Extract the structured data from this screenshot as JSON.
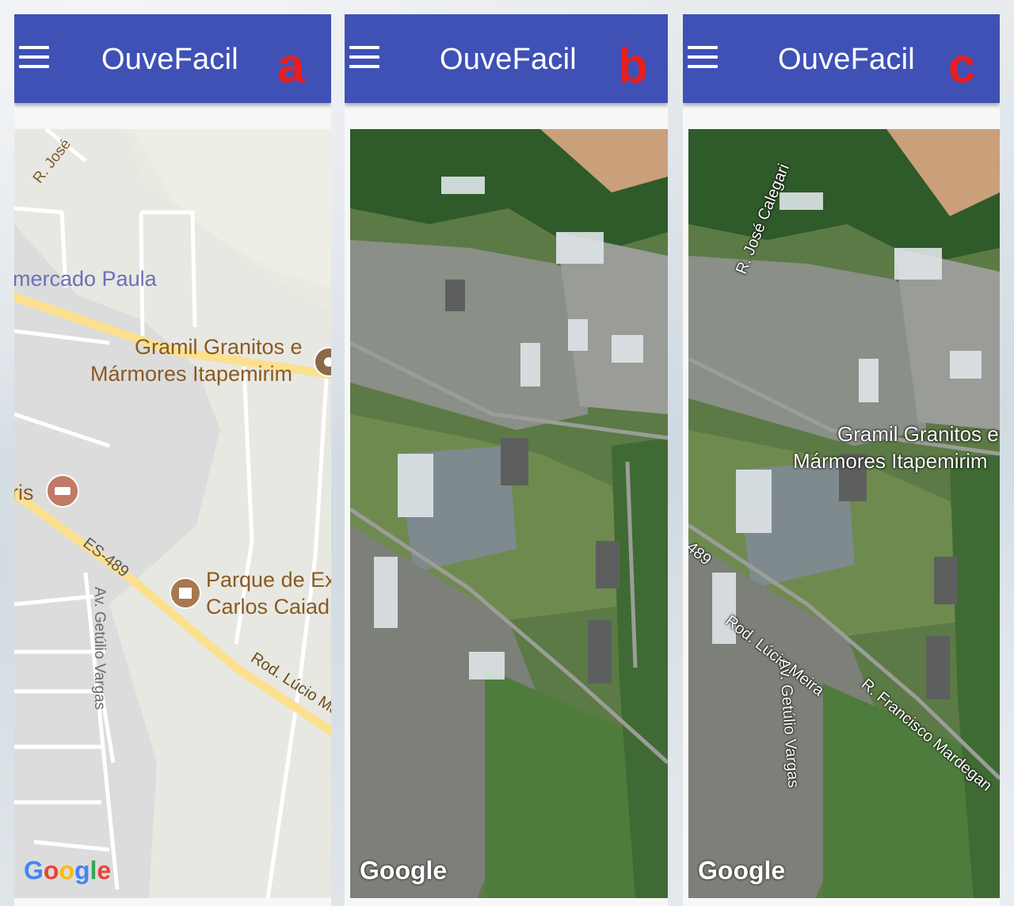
{
  "app": {
    "title": "OuveFacil",
    "accent_color": "#3f51b5",
    "label_color": "#e81e1e"
  },
  "panels": [
    {
      "letter": "a",
      "map_type": "roadmap",
      "labels": {
        "road_jose": "R. José",
        "mercado": "mercado Paula",
        "gramil_1": "Gramil Granitos e",
        "gramil_2": "Mármores Itapemirim",
        "iris": "ris",
        "es489": "ES-489",
        "getulio": "Av. Getúlio Vargas",
        "parque_1": "Parque de Ex",
        "parque_2": "Carlos Caiad",
        "lucio": "Rod. Lúcio Me"
      },
      "icons": [
        "place-icon",
        "hotel-icon",
        "park-icon"
      ],
      "attribution": "Google"
    },
    {
      "letter": "b",
      "map_type": "satellite",
      "attribution": "Google"
    },
    {
      "letter": "c",
      "map_type": "hybrid",
      "labels": {
        "calegari": "R. José Calegari",
        "gramil_1": "Gramil Granitos e",
        "gramil_2": "Mármores Itapemirim",
        "n489": "489",
        "lucio": "Rod. Lúcio Meira",
        "getulio": "Av. Getúlio Vargas",
        "francisco": "R. Francisco Mardegan"
      },
      "attribution": "Google"
    }
  ]
}
